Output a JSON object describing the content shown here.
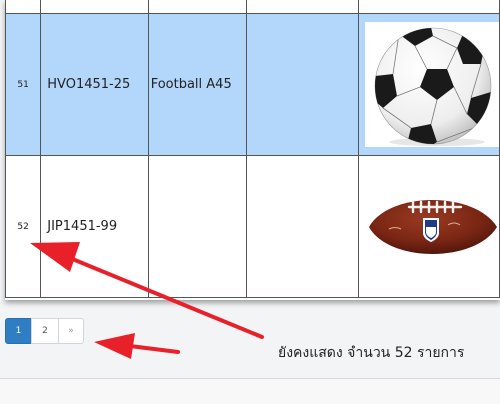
{
  "rows": [
    {
      "num": "51",
      "code": "HVO1451-25",
      "name": "Football A45",
      "image": "soccer-ball"
    },
    {
      "num": "52",
      "code": "JIP1451-99",
      "name": "",
      "image": "american-football"
    }
  ],
  "pagination": {
    "pages": [
      "1",
      "2"
    ],
    "next_label": "»",
    "current_page": "1"
  },
  "annotation": {
    "text": "ยังคงแสดง จำนวน 52 รายการ",
    "arrow_color": "#e8202a"
  },
  "colors": {
    "selected_row": "#b3d6fb",
    "active_page": "#2f7dc3"
  }
}
